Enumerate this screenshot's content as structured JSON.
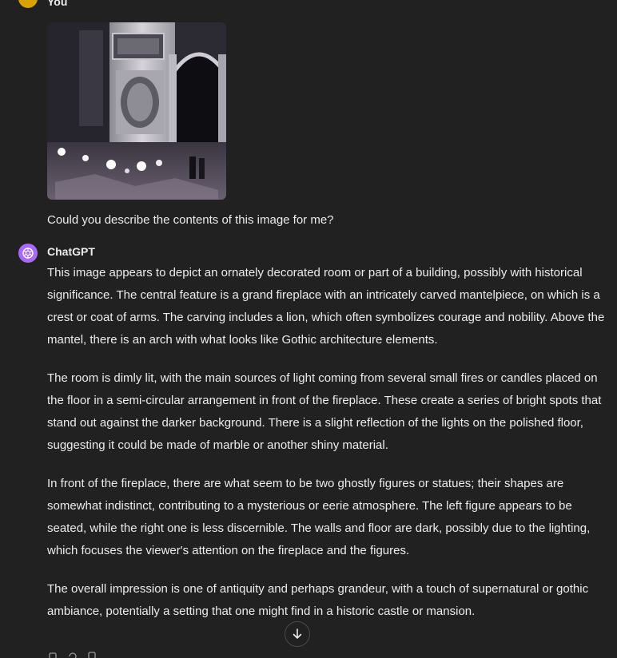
{
  "user": {
    "name": "You",
    "question": "Could you describe the contents of this image for me?"
  },
  "assistant": {
    "name": "ChatGPT",
    "paragraphs": [
      "This image appears to depict an ornately decorated room or part of a building, possibly with historical significance. The central feature is a grand fireplace with an intricately carved mantelpiece, on which is a crest or coat of arms. The carving includes a lion, which often symbolizes courage and nobility. Above the mantel, there is an arch with what looks like Gothic architecture elements.",
      "The room is dimly lit, with the main sources of light coming from several small fires or candles placed on the floor in a semi-circular arrangement in front of the fireplace. These create a series of bright spots that stand out against the darker background. There is a slight reflection of the lights on the polished floor, suggesting it could be made of marble or another shiny material.",
      "In front of the fireplace, there are what seem to be two ghostly figures or statues; their shapes are somewhat indistinct, contributing to a mysterious or eerie atmosphere. The left figure appears to be seated, while the right one is less discernible. The walls and floor are dark, possibly due to the lighting, which focuses the viewer's attention on the fireplace and the figures.",
      "The overall impression is one of antiquity and perhaps grandeur, with a touch of supernatural or gothic ambiance, potentially a setting that one might find in a historic castle or mansion."
    ]
  },
  "icons": {
    "user_avatar": "user-avatar-icon",
    "assistant_avatar": "openai-logo-icon",
    "scroll_down": "arrow-down-icon",
    "actions": [
      "copy-icon",
      "regenerate-icon",
      "thumbs-down-icon"
    ]
  },
  "colors": {
    "background": "#212121",
    "text": "#ececec",
    "user_avatar": "#d9a400",
    "assistant_avatar": "#ab68ff"
  }
}
